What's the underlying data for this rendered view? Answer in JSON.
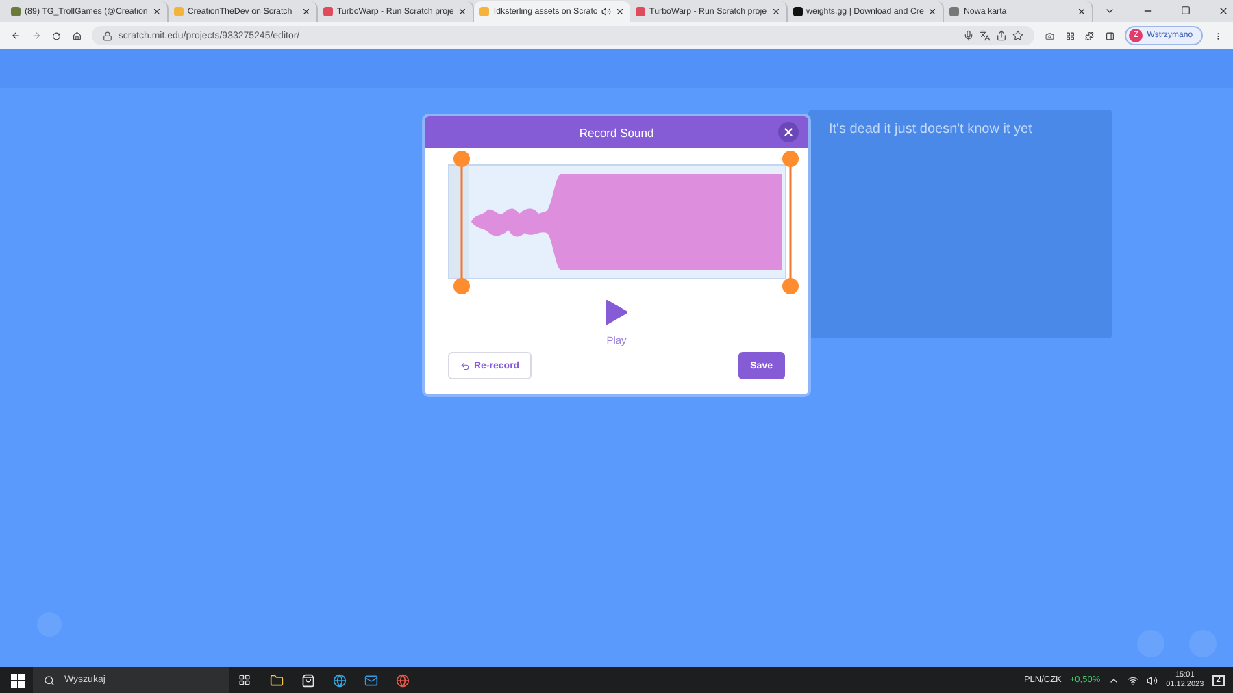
{
  "browser": {
    "tabs": [
      {
        "title": "(89) TG_TrollGames (@Creation",
        "kind": "avatar",
        "selected": false,
        "audio": false
      },
      {
        "title": "CreationTheDev on Scratch",
        "kind": "scratch",
        "selected": false,
        "audio": false
      },
      {
        "title": "TurboWarp - Run Scratch proje",
        "kind": "turbowarp",
        "selected": false,
        "audio": false
      },
      {
        "title": "Idksterling assets on Scratc",
        "kind": "scratch",
        "selected": true,
        "audio": true
      },
      {
        "title": "TurboWarp - Run Scratch proje",
        "kind": "turbowarp",
        "selected": false,
        "audio": false
      },
      {
        "title": "weights.gg | Download and Cre",
        "kind": "weights",
        "selected": false,
        "audio": false
      },
      {
        "title": "Nowa karta",
        "kind": "chrome",
        "selected": false,
        "audio": false
      }
    ],
    "url": "scratch.mit.edu/projects/933275245/editor/",
    "profile": {
      "initial": "Z",
      "label": "Wstrzymano"
    }
  },
  "stage": {
    "text": "It's dead it just doesn't know it yet"
  },
  "dialog": {
    "title": "Record Sound",
    "play_label": "Play",
    "buttons": [
      {
        "label": "Re-record",
        "kind": "secondary"
      },
      {
        "label": "Save",
        "kind": "primary"
      }
    ]
  },
  "taskbar": {
    "search": {
      "placeholder": "Wyszukaj"
    },
    "ticker": {
      "name": "PLN/CZK",
      "change": "+0,50%"
    },
    "time": "15:01",
    "date": "01.12.2023",
    "notifications": "2"
  }
}
